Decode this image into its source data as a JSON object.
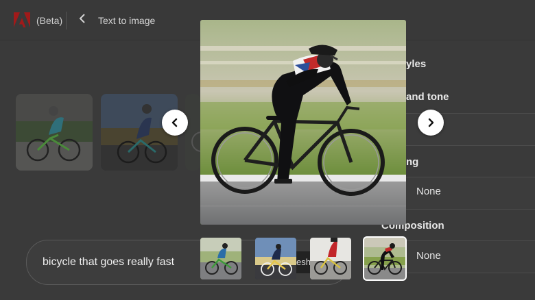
{
  "header": {
    "logo_icon": "adobe-logo-icon",
    "beta_label": "(Beta)",
    "back_icon": "chevron-left-icon",
    "page_title": "Text to image"
  },
  "settings_panel": {
    "styles_label": "yles",
    "color_tone_label": "and tone",
    "lighting_label": "ng",
    "lighting_value": "None",
    "composition_label": "Composition",
    "composition_value": "None"
  },
  "prompt": {
    "value": "bicycle that goes really fast",
    "refresh_peek": "esh"
  },
  "lightbox": {
    "prev_icon": "chevron-left-icon",
    "next_icon": "chevron-right-icon",
    "main_image": "cyclist-road-bike-motion-blur",
    "thumbnails": [
      {
        "image": "cyclist-green-bike",
        "selected": false
      },
      {
        "image": "cyclist-dramatic-light",
        "selected": false
      },
      {
        "image": "cyclist-red-kit",
        "selected": false
      },
      {
        "image": "cyclist-black-bike",
        "selected": true
      }
    ]
  },
  "colors": {
    "page_background": "#3a3a3a",
    "nav_button": "#ffffff",
    "selected_outline": "#ffffff"
  }
}
